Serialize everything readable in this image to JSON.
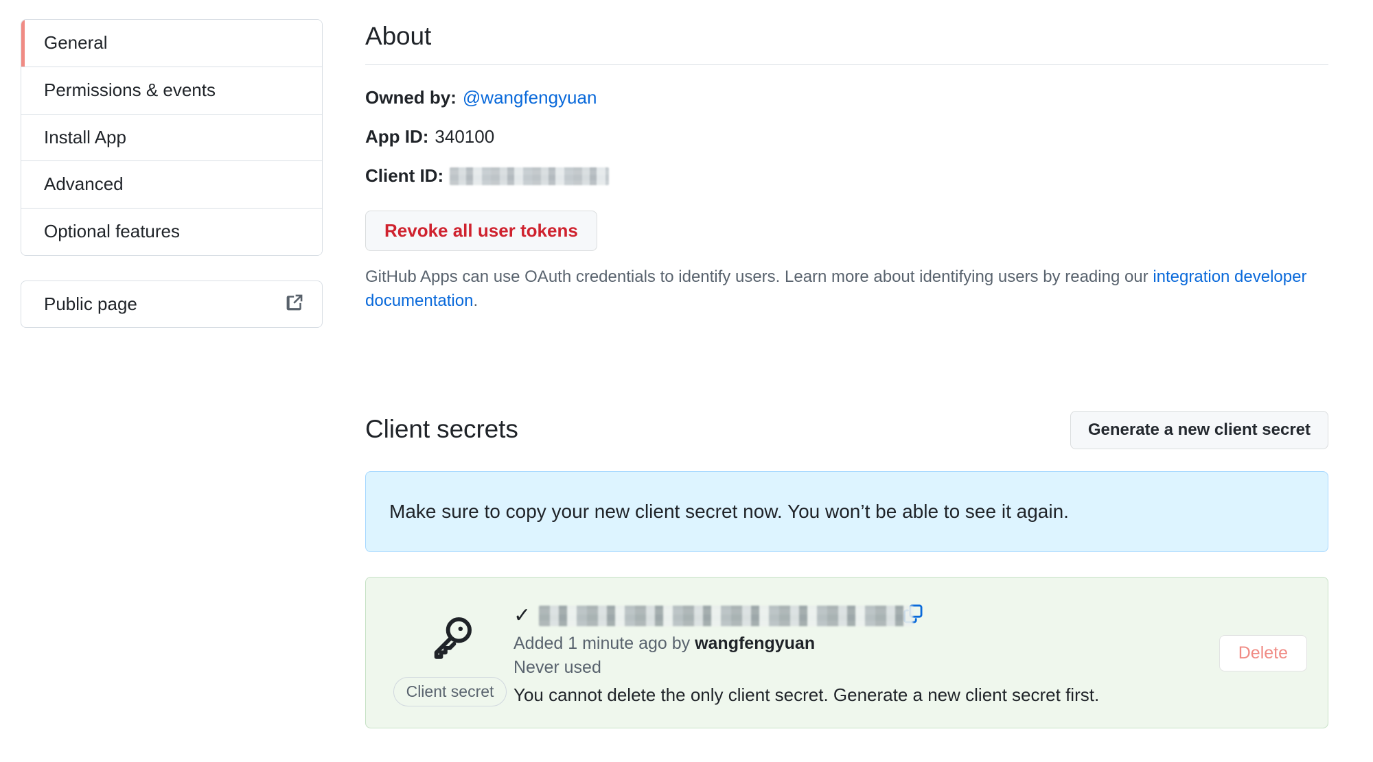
{
  "sidebar": {
    "items": [
      {
        "label": "General",
        "selected": true
      },
      {
        "label": "Permissions & events",
        "selected": false
      },
      {
        "label": "Install App",
        "selected": false
      },
      {
        "label": "Advanced",
        "selected": false
      },
      {
        "label": "Optional features",
        "selected": false
      }
    ],
    "public_page": {
      "label": "Public page",
      "icon": "external-link-icon"
    }
  },
  "about": {
    "title": "About",
    "owned_by_label": "Owned by:",
    "owner": "@wangfengyuan",
    "app_id_label": "App ID:",
    "app_id": "340100",
    "client_id_label": "Client ID:",
    "client_id_value": "",
    "revoke_button": "Revoke all user tokens",
    "note_prefix": "GitHub Apps can use OAuth credentials to identify users. Learn more about identifying users by reading our ",
    "note_link": "integration developer documentation",
    "note_suffix": "."
  },
  "client_secrets": {
    "title": "Client secrets",
    "generate_button": "Generate a new client secret",
    "flash_message": "Make sure to copy your new client secret now. You won’t be able to see it again.",
    "secret": {
      "value": "",
      "badge": "Client secret",
      "added_prefix": "Added 1 minute ago by ",
      "added_user": "wangfengyuan",
      "usage": "Never used",
      "cannot_delete": "You cannot delete the only client secret. Generate a new client secret first.",
      "delete_button": "Delete",
      "check_glyph": "✓",
      "key_icon": "key-icon",
      "copy_icon": "copy-icon"
    }
  },
  "colors": {
    "accent_link": "#0969da",
    "danger": "#cf222e",
    "danger_muted": "#f08b84",
    "selected_bar": "#f08b84",
    "flash_blue_bg": "#ddf4ff",
    "secret_green_bg": "#eff7ed",
    "border": "#d8dee4",
    "muted_text": "#59636e"
  }
}
